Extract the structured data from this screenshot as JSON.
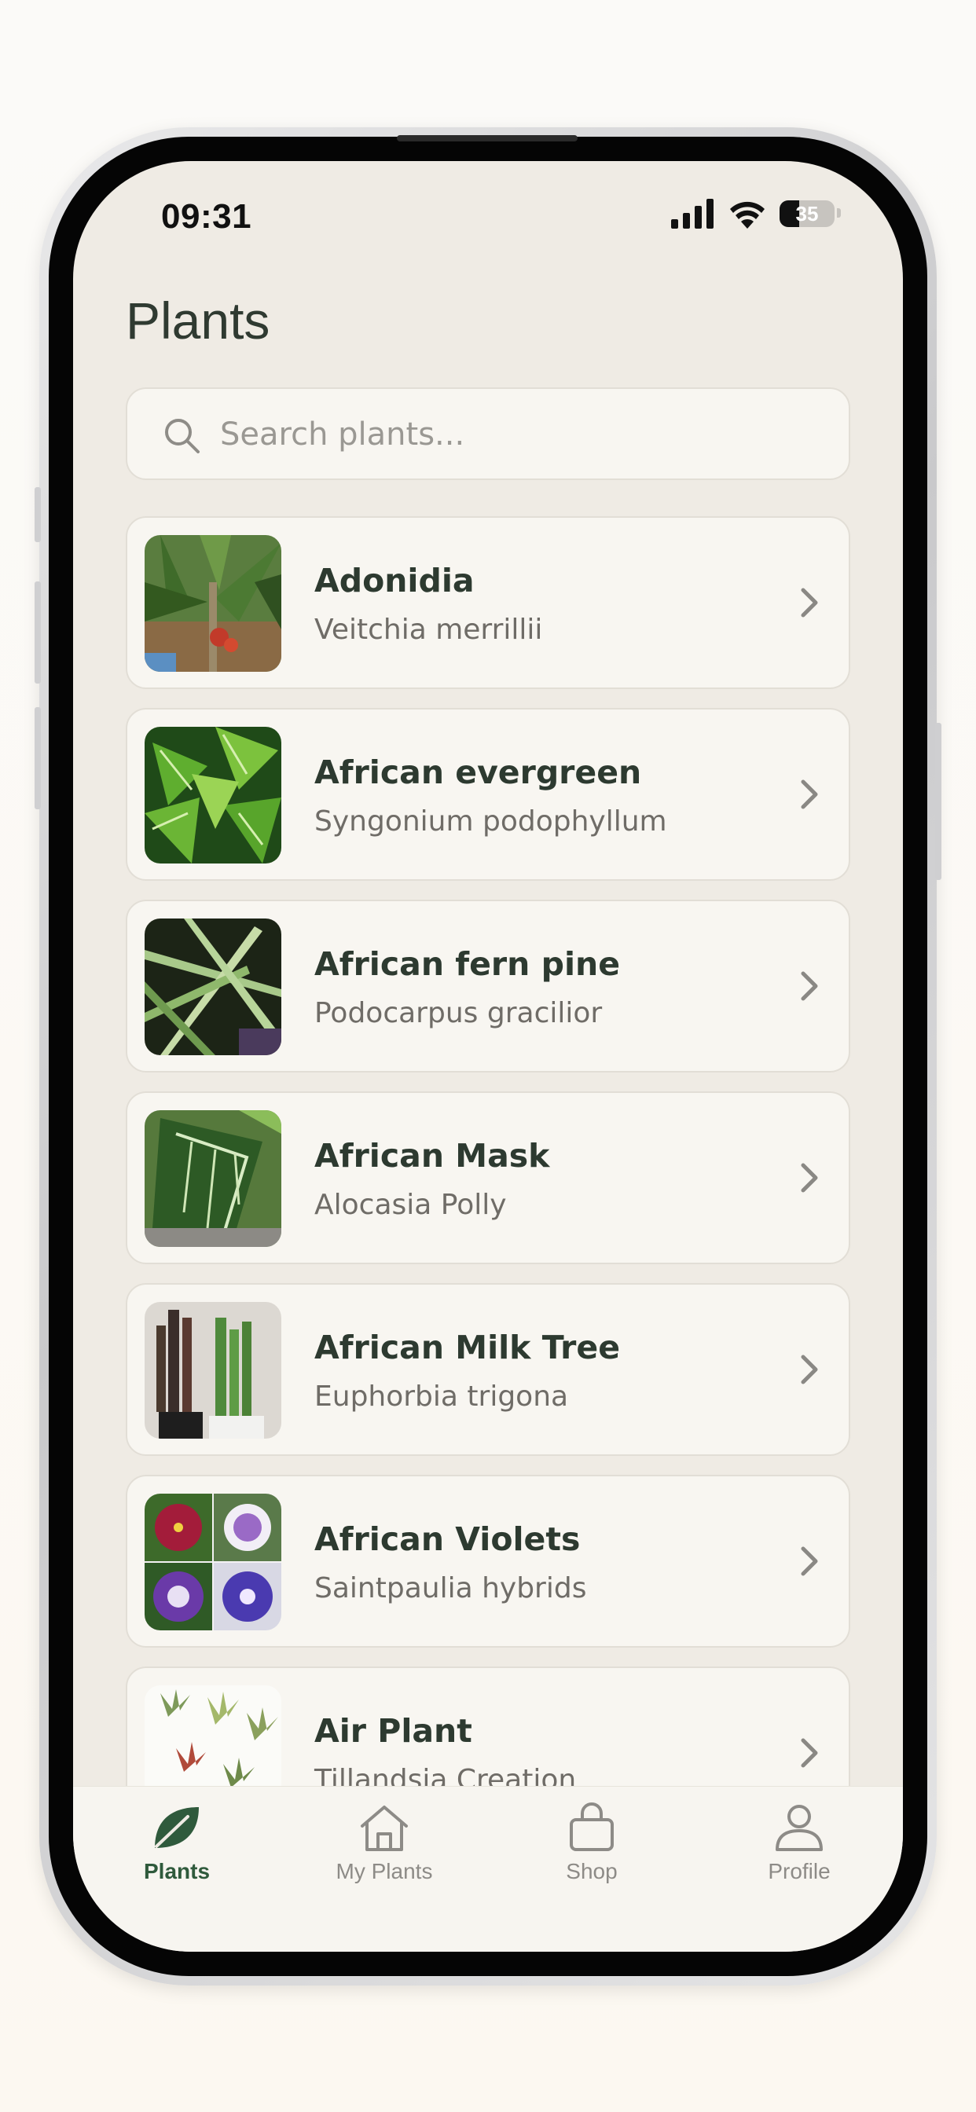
{
  "status_bar": {
    "time": "09:31",
    "battery": "35",
    "battery_level": 0.35
  },
  "header": {
    "title": "Plants"
  },
  "search": {
    "placeholder": "Search plants..."
  },
  "plants": [
    {
      "name": "Adonidia",
      "scientific": "Veitchia merrillii",
      "thumb": "palm-tree-photo"
    },
    {
      "name": "African evergreen",
      "scientific": "Syngonium podophyllum",
      "thumb": "arrowhead-leaves-photo"
    },
    {
      "name": "African fern pine",
      "scientific": "Podocarpus gracilior",
      "thumb": "fern-pine-fronds-photo"
    },
    {
      "name": "African Mask",
      "scientific": "Alocasia Polly",
      "thumb": "alocasia-leaf-photo"
    },
    {
      "name": "African Milk Tree",
      "scientific": "Euphorbia trigona",
      "thumb": "cactus-pots-photo"
    },
    {
      "name": "African Violets",
      "scientific": "Saintpaulia hybrids",
      "thumb": "violet-flowers-grid-photo"
    },
    {
      "name": "Air Plant",
      "scientific": "Tillandsia Creation",
      "thumb": "air-plants-photo"
    }
  ],
  "tabs": [
    {
      "label": "Plants",
      "icon": "leaf-icon",
      "active": true
    },
    {
      "label": "My Plants",
      "icon": "home-icon",
      "active": false
    },
    {
      "label": "Shop",
      "icon": "shopping-bag-icon",
      "active": false
    },
    {
      "label": "Profile",
      "icon": "profile-icon",
      "active": false
    }
  ],
  "colors": {
    "accent": "#2f5a3c",
    "background": "#efebe4",
    "card": "#f8f6f1",
    "text_primary": "#2d3a30",
    "text_secondary": "#6f6c67"
  }
}
